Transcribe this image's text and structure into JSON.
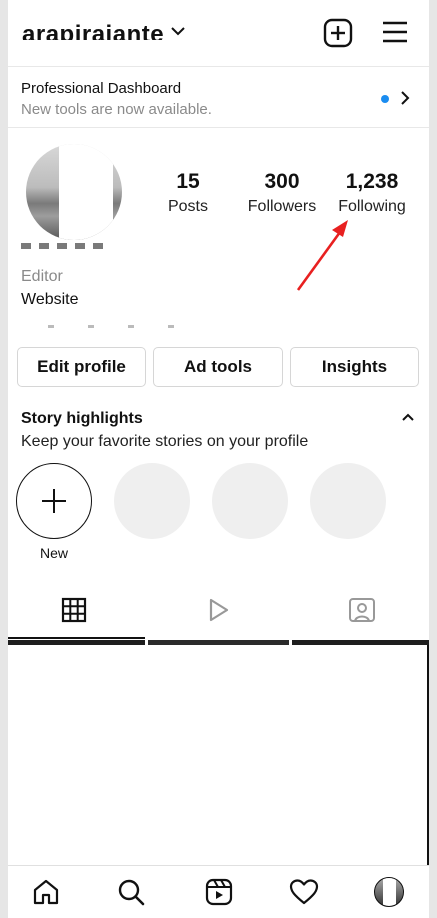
{
  "header": {
    "username": "arapirajante",
    "new_post_icon": "plus-square-icon",
    "menu_icon": "hamburger-icon"
  },
  "dashboard": {
    "title": "Professional Dashboard",
    "subtitle": "New tools are now available.",
    "dot_color": "#1a8cf0"
  },
  "profile": {
    "stats": [
      {
        "value": "15",
        "label": "Posts"
      },
      {
        "value": "300",
        "label": "Followers"
      },
      {
        "value": "1,238",
        "label": "Following"
      }
    ],
    "category": "Editor",
    "website": "Website"
  },
  "actions": {
    "edit_profile": "Edit profile",
    "ad_tools": "Ad tools",
    "insights": "Insights"
  },
  "highlights": {
    "title": "Story highlights",
    "subtitle": "Keep your favorite stories on your profile",
    "new_label": "New"
  },
  "tabs": [
    "grid-icon",
    "reels-icon",
    "tagged-icon"
  ],
  "nav": [
    "home-icon",
    "search-icon",
    "reels-icon",
    "heart-icon",
    "profile-avatar"
  ],
  "colors": {
    "annotation_arrow": "#e82020"
  }
}
